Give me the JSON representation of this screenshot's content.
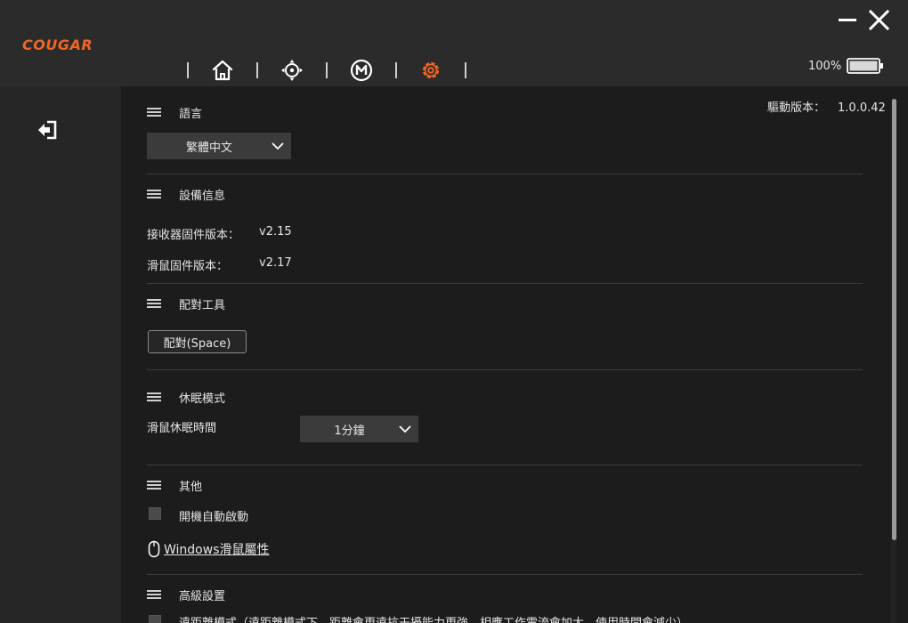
{
  "app": {
    "logo": "COUGAR"
  },
  "window": {
    "minimize": "minimize-icon",
    "close": "close-icon"
  },
  "nav": {
    "tabs": [
      {
        "icon": "home-icon",
        "active": false
      },
      {
        "icon": "dpi-icon",
        "active": false
      },
      {
        "icon": "macro-icon",
        "active": false
      },
      {
        "icon": "gear-icon",
        "active": true
      }
    ],
    "accent": "#f26522"
  },
  "battery": {
    "label": "100%",
    "level": 1.0
  },
  "sidebar": {
    "back_icon": "exit-icon"
  },
  "driver": {
    "label": "驅動版本：",
    "version": "1.0.0.42"
  },
  "sections": {
    "language": {
      "title": "語言",
      "selected": "繁體中文"
    },
    "device": {
      "title": "設備信息",
      "receiver_label": "接收器固件版本：",
      "receiver_value": "v2.15",
      "mouse_label": "滑鼠固件版本：",
      "mouse_value": "v2.17"
    },
    "pairing": {
      "title": "配對工具",
      "button": "配對(Space)"
    },
    "sleep": {
      "title": "休眠模式",
      "label": "滑鼠休眠時間",
      "selected": "1分鐘"
    },
    "other": {
      "title": "其他",
      "autostart": "開機自動啟動",
      "autostart_checked": false,
      "mouse_props": "Windows滑鼠屬性"
    },
    "advanced": {
      "title": "高級設置",
      "long_distance": "遠距離模式（遠距離模式下，距離會更遠抗干擾能力更強，相應工作電流會加大，使用時間會減少）"
    }
  }
}
